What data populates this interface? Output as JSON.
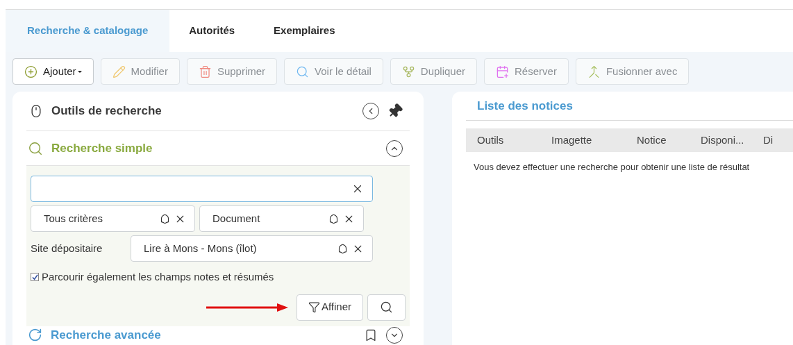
{
  "tabs": [
    {
      "label": "Recherche & catalogage",
      "selected": true
    },
    {
      "label": "Autorités",
      "selected": false
    },
    {
      "label": "Exemplaires",
      "selected": false
    }
  ],
  "toolbar": [
    {
      "label": "Ajouter",
      "kind": "add",
      "disabled": false,
      "dropdown": true
    },
    {
      "label": "Modifier",
      "kind": "edit",
      "disabled": true,
      "dropdown": false
    },
    {
      "label": "Supprimer",
      "kind": "delete",
      "disabled": true,
      "dropdown": false
    },
    {
      "label": "Voir le détail",
      "kind": "view",
      "disabled": true,
      "dropdown": false
    },
    {
      "label": "Dupliquer",
      "kind": "duplicate",
      "disabled": true,
      "dropdown": false
    },
    {
      "label": "Réserver",
      "kind": "reserve",
      "disabled": true,
      "dropdown": false
    },
    {
      "label": "Fusionner avec",
      "kind": "merge",
      "disabled": true,
      "dropdown": false
    }
  ],
  "search_panel": {
    "title": "Outils de recherche",
    "simple": {
      "title": "Recherche simple",
      "expanded": true,
      "criteria": [
        {
          "value": "Tous critères"
        },
        {
          "value": "Document"
        }
      ],
      "site": {
        "label": "Site dépositaire",
        "value": "Lire à Mons - Mons (îlot)"
      },
      "notes_option": {
        "label": "Parcourir également les champs notes et résumés",
        "checked": true
      },
      "refine_button": "Affiner"
    },
    "advanced": {
      "title": "Recherche avancée",
      "expanded": false
    }
  },
  "results": {
    "title": "Liste des notices",
    "columns": [
      "Outils",
      "Imagette",
      "Notice",
      "Disponi...",
      "Di"
    ],
    "empty_message": "Vous devez effectuer une recherche pour obtenir une liste de résultat"
  }
}
